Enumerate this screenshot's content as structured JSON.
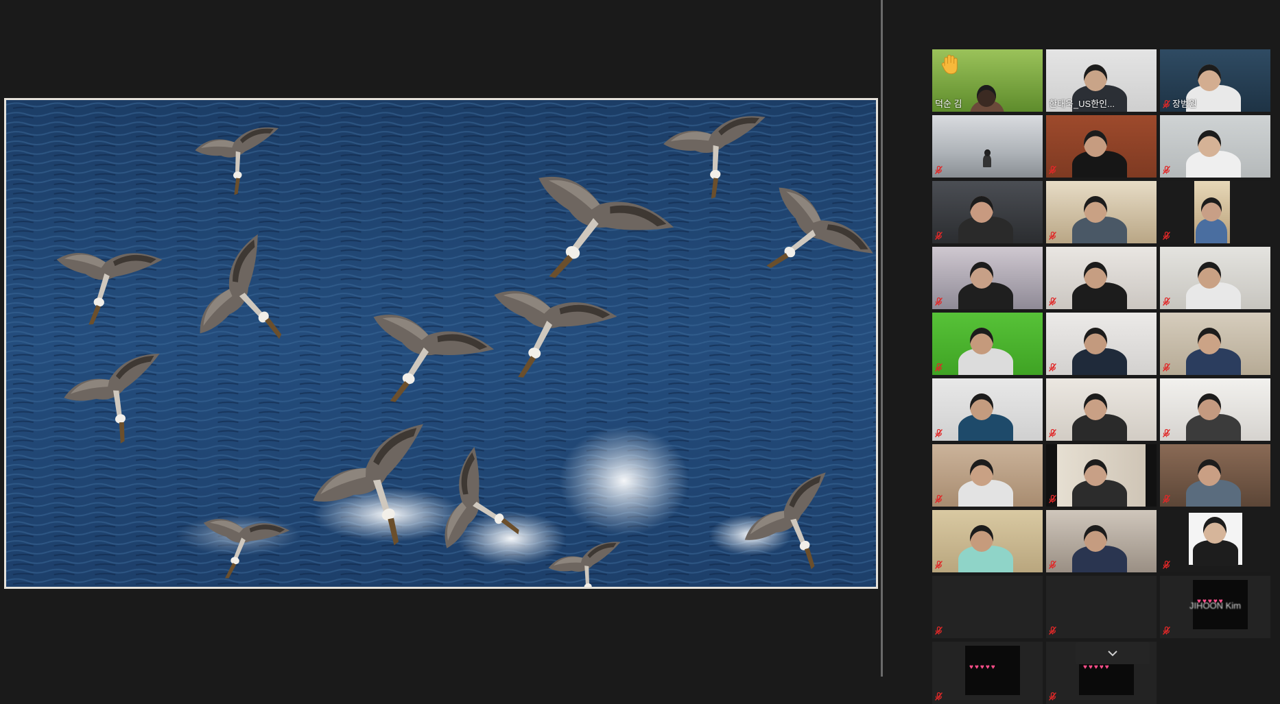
{
  "gallery": {
    "participants": [
      {
        "name": "덕순 김",
        "raised_hand": true,
        "muted": false,
        "active": false,
        "clear": true
      },
      {
        "name": "한태욱_US한인...",
        "raised_hand": false,
        "muted": false,
        "active": true,
        "clear": true
      },
      {
        "name": "장범원",
        "raised_hand": false,
        "muted": true,
        "active": false,
        "clear": true
      },
      {
        "name": "",
        "muted": true
      },
      {
        "name": "",
        "muted": true
      },
      {
        "name": "",
        "muted": true
      },
      {
        "name": "",
        "muted": true
      },
      {
        "name": "",
        "muted": true
      },
      {
        "name": "",
        "muted": true
      },
      {
        "name": "",
        "muted": true
      },
      {
        "name": "",
        "muted": true
      },
      {
        "name": "",
        "muted": true
      },
      {
        "name": "",
        "muted": true
      },
      {
        "name": "",
        "muted": true
      },
      {
        "name": "",
        "muted": true
      },
      {
        "name": "",
        "muted": true
      },
      {
        "name": "",
        "muted": true
      },
      {
        "name": "",
        "muted": true
      },
      {
        "name": "",
        "muted": true
      },
      {
        "name": "",
        "muted": true
      },
      {
        "name": "",
        "muted": true
      },
      {
        "name": "",
        "muted": true
      },
      {
        "name": "",
        "muted": true
      },
      {
        "name": "",
        "muted": true
      },
      {
        "name": "",
        "muted": true
      },
      {
        "name": "",
        "muted": true
      },
      {
        "name": "JIHOON Kim",
        "muted": true,
        "no_video": true,
        "clear": true
      },
      {
        "name": "",
        "muted": true,
        "no_video": true
      },
      {
        "name": "",
        "muted": true
      }
    ]
  },
  "icons": {
    "raised_hand": "raised-hand-icon",
    "mute": "mic-muted-icon",
    "scroll": "chevron-down-icon"
  },
  "colors": {
    "active_speaker_border": "#c9e35a",
    "mute_red": "#e02828",
    "background": "#1a1a1a"
  }
}
